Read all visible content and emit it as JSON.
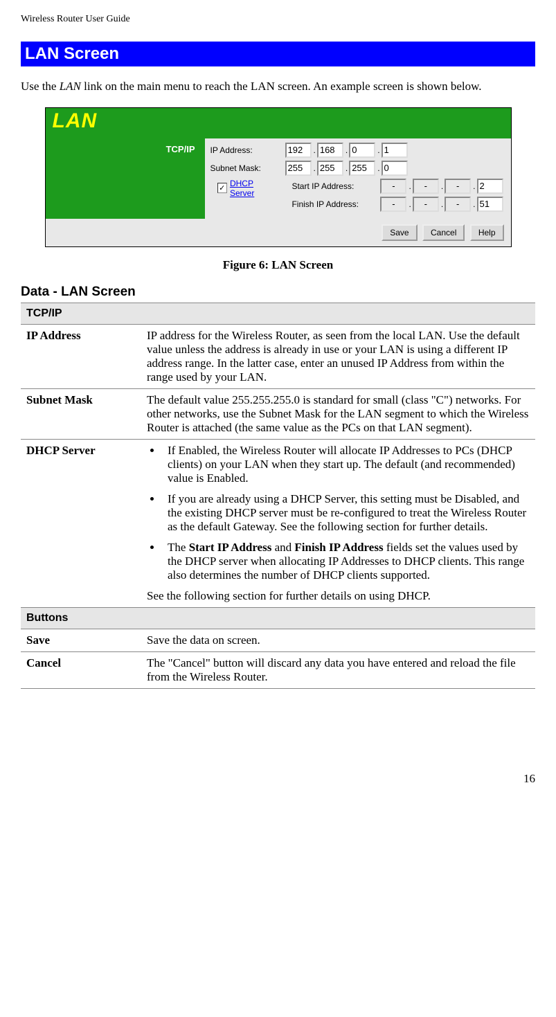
{
  "doc_header": "Wireless Router User Guide",
  "section_heading": "LAN Screen",
  "intro_prefix": "Use the ",
  "intro_em": "LAN",
  "intro_suffix": " link on the main menu to reach the LAN screen. An example screen is shown below.",
  "screenshot": {
    "title": "LAN",
    "sidebar_label": "TCP/IP",
    "ip_address_label": "IP Address:",
    "ip_address": [
      "192",
      "168",
      "0",
      "1"
    ],
    "subnet_mask_label": "Subnet Mask:",
    "subnet_mask": [
      "255",
      "255",
      "255",
      "0"
    ],
    "dhcp_checked": true,
    "dhcp_link": "DHCP Server",
    "start_ip_label": "Start IP Address:",
    "start_ip": [
      "-",
      "-",
      "-",
      "2"
    ],
    "finish_ip_label": "Finish IP Address:",
    "finish_ip": [
      "-",
      "-",
      "-",
      "51"
    ],
    "buttons": {
      "save": "Save",
      "cancel": "Cancel",
      "help": "Help"
    }
  },
  "figure_caption": "Figure 6: LAN Screen",
  "data_heading": "Data - LAN Screen",
  "table": {
    "tcpip_header": "TCP/IP",
    "ip_address": {
      "label": "IP Address",
      "desc": "IP address for the Wireless Router, as seen from the local LAN. Use the default value unless the address is already in use or your LAN is using a different IP address range. In the latter case, enter an unused IP Address from within the range used by your LAN."
    },
    "subnet_mask": {
      "label": "Subnet Mask",
      "desc": "The default value 255.255.255.0 is standard for small (class \"C\") networks. For other networks, use the Subnet Mask for the LAN segment to which the Wireless Router is attached (the same value as the PCs on that LAN segment)."
    },
    "dhcp_server": {
      "label": "DHCP Server",
      "bullet1": "If Enabled, the Wireless Router will allocate IP Addresses to PCs (DHCP clients) on your LAN when they start up. The default (and recommended) value is Enabled.",
      "bullet2": "If you are already using a DHCP Server, this setting must be Disabled, and the existing DHCP server must be re-configured to treat the Wireless Router as the default Gateway. See the following section for further details.",
      "bullet3_pre": "The ",
      "bullet3_b1": "Start IP Address",
      "bullet3_mid": " and ",
      "bullet3_b2": "Finish IP Address",
      "bullet3_post": " fields set the values used by the DHCP server when allocating IP Addresses to DHCP clients. This range also determines the number of DHCP clients supported.",
      "footer": "See the following section for further details on using DHCP."
    },
    "buttons_header": "Buttons",
    "save": {
      "label": "Save",
      "desc": "Save the data on screen."
    },
    "cancel": {
      "label": "Cancel",
      "desc": "The \"Cancel\" button will discard any data you have entered and reload the file from the Wireless Router."
    }
  },
  "page_number": "16"
}
